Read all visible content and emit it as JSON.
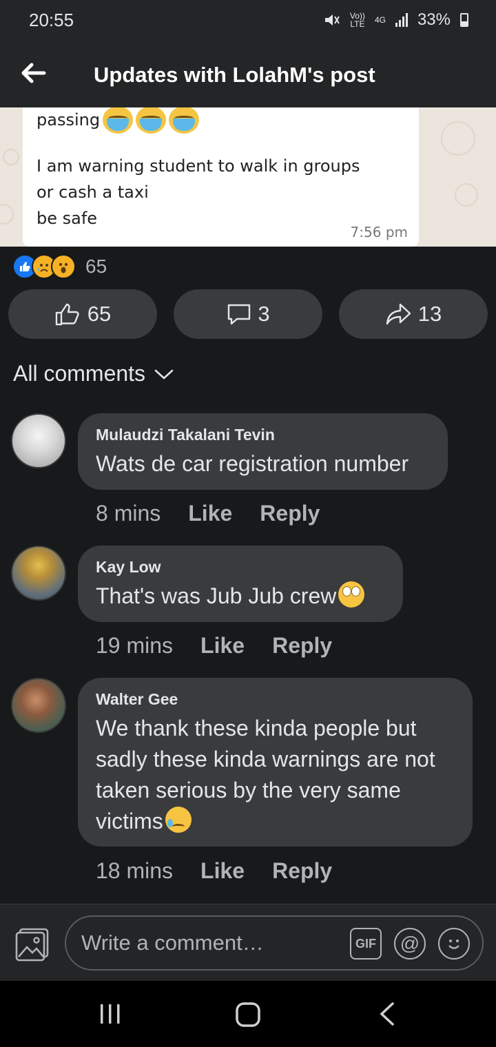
{
  "status_bar": {
    "time": "20:55",
    "volte": "Vo))",
    "lte": "LTE",
    "network": "4G",
    "battery": "33%"
  },
  "app_bar": {
    "title": "Updates with LolahM's post"
  },
  "post_image": {
    "line_partial": "passing",
    "line_2": "I am warning student to walk in groups",
    "line_3": "or cash a taxi",
    "line_4": "be safe",
    "time": "7:56 pm"
  },
  "reactions": {
    "icons": [
      "like-icon",
      "sad-icon",
      "wow-icon"
    ],
    "count": "65"
  },
  "actions": {
    "like_count": "65",
    "comment_count": "3",
    "share_count": "13"
  },
  "filter": {
    "label": "All comments"
  },
  "comments": [
    {
      "author": "Mulaudzi Takalani Tevin",
      "text": "Wats de car registration number",
      "time": "8 mins",
      "like": "Like",
      "reply": "Reply"
    },
    {
      "author": "Kay Low",
      "text": "That's was Jub Jub crew",
      "time": "19 mins",
      "like": "Like",
      "reply": "Reply"
    },
    {
      "author": "Walter Gee",
      "text": "We thank these kinda people but sadly these kinda warnings are not taken serious by the very same victims",
      "time": "18 mins",
      "like": "Like",
      "reply": "Reply"
    }
  ],
  "composer": {
    "placeholder": "Write a comment…",
    "gif_label": "GIF",
    "mention_label": "@"
  },
  "colors": {
    "background": "#18191a",
    "surface": "#3a3b3c",
    "bar": "#242526",
    "like_blue": "#1877f2"
  }
}
